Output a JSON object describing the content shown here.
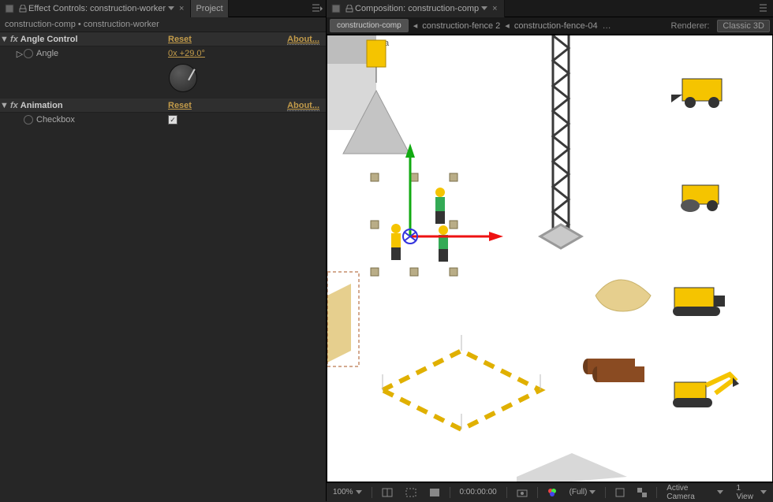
{
  "leftPanel": {
    "activeTab": "Effect Controls: construction-worker",
    "inactiveTab": "Project",
    "breadcrumb": "construction-comp • construction-worker",
    "effects": [
      {
        "name": "Angle Control",
        "reset": "Reset",
        "about": "About...",
        "props": [
          {
            "name": "Angle",
            "value": "0x +29.0°",
            "type": "dial"
          }
        ]
      },
      {
        "name": "Animation",
        "reset": "Reset",
        "about": "About...",
        "props": [
          {
            "name": "Checkbox",
            "value": "checked",
            "type": "checkbox"
          }
        ]
      }
    ]
  },
  "rightPanel": {
    "tabTitle": "Composition: construction-comp",
    "compTabs": {
      "active": "construction-comp",
      "others": [
        "construction-fence 2",
        "construction-fence-04"
      ]
    },
    "renderer": {
      "label": "Renderer:",
      "value": "Classic 3D"
    },
    "cameraLabel": "Active Camera"
  },
  "toolbar": {
    "zoom": "100%",
    "timecode": "0:00:00:00",
    "resolution": "(Full)",
    "camera": "Active Camera",
    "views": "1 View"
  }
}
